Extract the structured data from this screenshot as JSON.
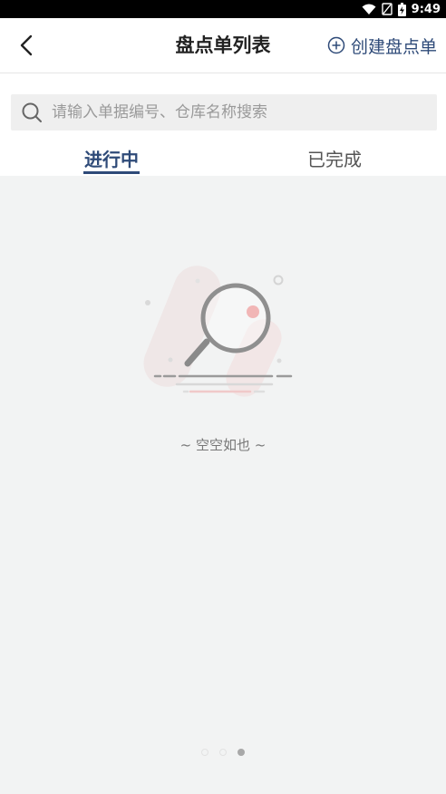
{
  "status_bar": {
    "time": "9:49",
    "icons": [
      "wifi-icon",
      "no-sim-icon",
      "battery-charging-icon"
    ]
  },
  "header": {
    "title": "盘点单列表",
    "create_label": "创建盘点单",
    "back_icon": "chevron-left-icon",
    "create_icon": "plus-circle-icon"
  },
  "search": {
    "placeholder": "请输入单据编号、仓库名称搜索",
    "value": ""
  },
  "tabs": [
    {
      "label": "进行中",
      "active": true
    },
    {
      "label": "已完成",
      "active": false
    }
  ],
  "empty_state": {
    "message": "~ 空空如也 ~",
    "icon": "magnifier-empty-illustration"
  },
  "pager": {
    "count": 3,
    "active_index": 2
  },
  "colors": {
    "accent": "#2e4a78",
    "background": "#f2f3f3"
  }
}
